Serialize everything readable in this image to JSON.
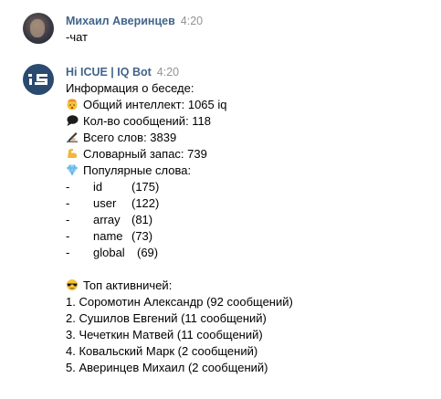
{
  "messages": [
    {
      "author": "Михаил Аверинцев",
      "time": "4:20",
      "text": "-чат"
    },
    {
      "author": "Hi ICUE | IQ Bot",
      "time": "4:20",
      "header": "Информация о беседе:",
      "stats": {
        "iq": "Общий интеллект: 1065 iq",
        "messages": "Кол-во сообщений: 118",
        "words": "Всего слов: 3839",
        "vocab": "Словарный запас: 739",
        "popular": "Популярные слова:"
      },
      "popular_words": [
        {
          "dash": "-",
          "word": "id",
          "count": "(175)"
        },
        {
          "dash": "-",
          "word": "user",
          "count": "(122)"
        },
        {
          "dash": "-",
          "word": "array",
          "count": "(81)"
        },
        {
          "dash": "-",
          "word": "name",
          "count": "(73)"
        },
        {
          "dash": "-",
          "word": "global",
          "count": "(69)"
        }
      ],
      "top_title": "Топ активничей:",
      "top_list": [
        "1. Соромотин Александр (92 сообщений)",
        "2. Сушилов Евгений (11 сообщений)",
        "3. Чечеткин Матвей (11 сообщений)",
        "4. Ковальский Марк (2 сообщений)",
        "5. Аверинцев Михаил (2 сообщений)"
      ]
    }
  ],
  "icons": {
    "iq": "exploding-head-emoji",
    "messages": "speech-bubble-emoji",
    "words": "writing-hand-emoji",
    "vocab": "flexed-biceps-emoji",
    "popular": "gem-emoji",
    "top": "sunglasses-face-emoji"
  }
}
